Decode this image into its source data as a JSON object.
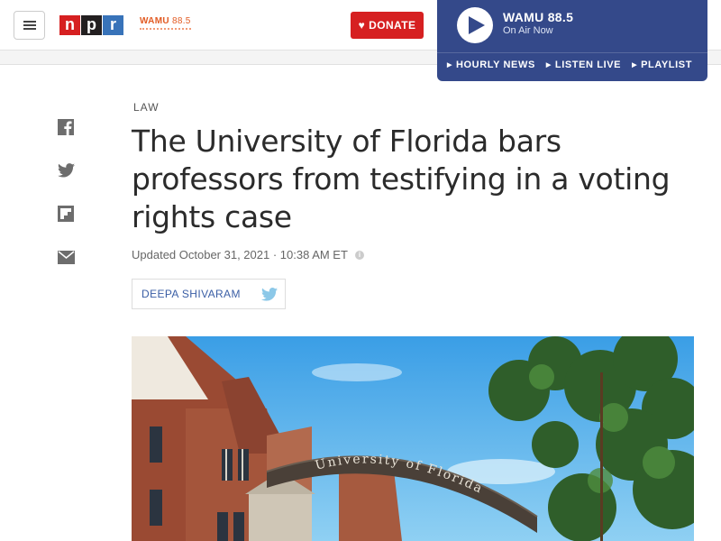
{
  "header": {
    "menu_icon": "hamburger-icon",
    "npr_logo_letters": [
      "n",
      "p",
      "r"
    ],
    "wamu_logo_name": "WAMU",
    "wamu_logo_freq": "88.5",
    "donate_label": "DONATE",
    "donate_icon": "heart-icon"
  },
  "player": {
    "station": "WAMU 88.5",
    "status": "On Air Now",
    "links": [
      "HOURLY NEWS",
      "LISTEN LIVE",
      "PLAYLIST"
    ],
    "accent": "#34498a"
  },
  "share": {
    "icons": [
      "facebook-icon",
      "twitter-icon",
      "flipboard-icon",
      "email-icon"
    ]
  },
  "article": {
    "slug": "LAW",
    "title": "The University of Florida bars professors from testifying in a voting rights case",
    "dateline": "Updated October 31, 2021 · 10:38 AM ET",
    "byline": "DEEPA SHIVARAM",
    "photo_sign_text": "University of Florida"
  },
  "colors": {
    "npr_red": "#d62021",
    "npr_black": "#231f20",
    "npr_blue": "#3873b9",
    "wamu_orange": "#e25b23",
    "link_blue": "#3a5ea5"
  }
}
